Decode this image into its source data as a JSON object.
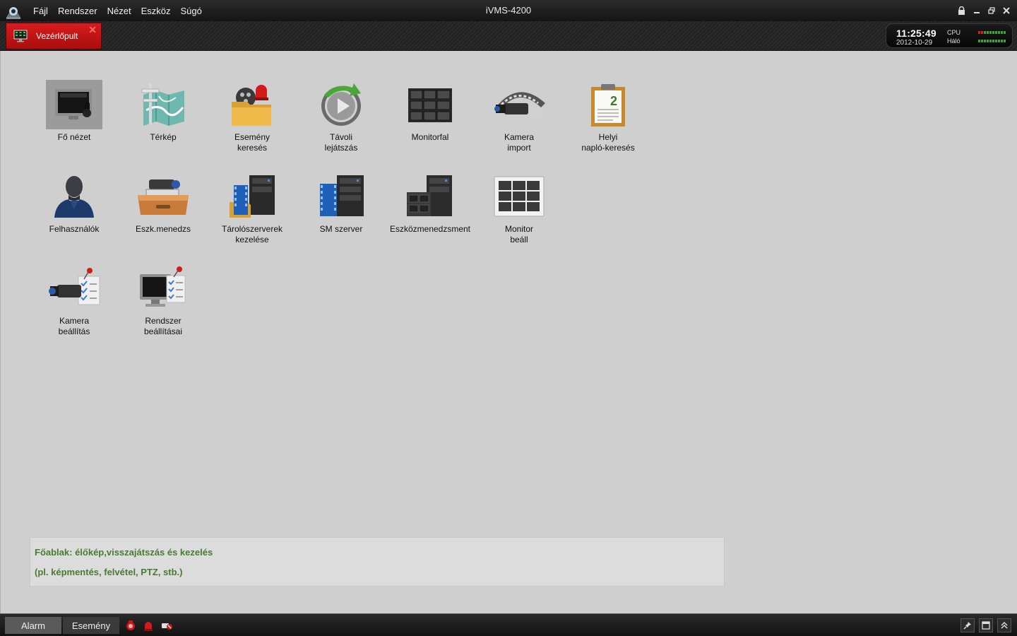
{
  "window": {
    "title": "iVMS-4200",
    "menu": [
      {
        "label": "Fájl"
      },
      {
        "label": "Rendszer"
      },
      {
        "label": "Nézet"
      },
      {
        "label": "Eszköz"
      },
      {
        "label": "Súgó"
      }
    ],
    "controls": [
      "lock-icon",
      "minimize-icon",
      "restore-icon",
      "close-icon"
    ]
  },
  "tab": {
    "label": "Vezérlőpult",
    "close": "✕"
  },
  "status": {
    "time": "11:25:49",
    "date": "2012-10-29",
    "cpu_label": "CPU",
    "net_label": "Háló"
  },
  "tiles": [
    {
      "label": "Fő nézet",
      "icon": "main-view-icon",
      "selected": true
    },
    {
      "label": "Térkép",
      "icon": "map-icon"
    },
    {
      "label": "Esemény\nkeresés",
      "icon": "event-search-icon"
    },
    {
      "label": "Távoli\nlejátszás",
      "icon": "remote-playback-icon"
    },
    {
      "label": "Monitorfal",
      "icon": "video-wall-icon"
    },
    {
      "label": "Kamera\nimport",
      "icon": "camera-import-icon"
    },
    {
      "label": "Helyi\nnapló-keresés",
      "icon": "local-log-search-icon"
    },
    {
      "label": "Felhasználók",
      "icon": "users-icon"
    },
    {
      "label": "Eszk.menedzs",
      "icon": "device-management-icon"
    },
    {
      "label": "Tárolószerverek\nkezelése",
      "icon": "storage-server-icon"
    },
    {
      "label": "SM szerver",
      "icon": "sm-server-icon"
    },
    {
      "label": "Eszközmenedzsment",
      "icon": "device-manager-icon"
    },
    {
      "label": "Monitor\nbeáll",
      "icon": "monitor-settings-icon"
    },
    {
      "label": "Kamera\nbeállítás",
      "icon": "camera-settings-icon"
    },
    {
      "label": "Rendszer\nbeállításai",
      "icon": "system-settings-icon"
    }
  ],
  "description": {
    "line1": "Főablak: élőkép,visszajátszás és kezelés",
    "line2": "(pl. képmentés, felvétel, PTZ, stb.)"
  },
  "bottom": {
    "alarm_tab": "Alarm",
    "event_tab": "Esemény"
  },
  "colors": {
    "accent_red": "#c41414",
    "description_green": "#4a7a32"
  }
}
